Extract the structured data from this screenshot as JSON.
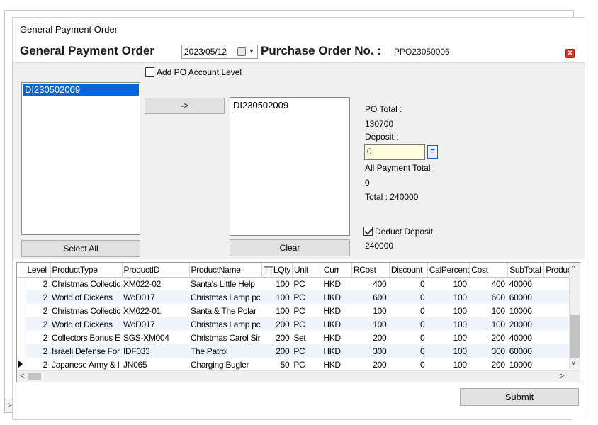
{
  "window": {
    "caption": "General Payment Order"
  },
  "header": {
    "title": "General Payment Order",
    "date": "2023/05/12",
    "po_label": "Purchase Order No. :",
    "po_number": "PPO23050006"
  },
  "left_panel": {
    "add_po_account_level": {
      "label": "Add PO Account Level",
      "checked": false
    },
    "items": [
      "DI230502009"
    ],
    "selected": "DI230502009",
    "select_all_label": "Select All"
  },
  "move_button_label": "->",
  "right_panel": {
    "items": [
      "DI230502009"
    ],
    "clear_label": "Clear"
  },
  "summary": {
    "po_total_label": "PO Total :",
    "po_total_value": "130700",
    "deposit_label": "Deposit :",
    "deposit_value": "0",
    "equals_label": "=",
    "all_payment_total_label": "All Payment Total :",
    "all_payment_total_value": "0",
    "total_text": "Total :  240000",
    "deduct_deposit": {
      "label": "Deduct Deposit",
      "checked": true
    },
    "deduct_value": "240000"
  },
  "grid": {
    "columns": [
      "Level",
      "ProductType",
      "ProductID",
      "ProductName",
      "TTLQty",
      "Unit",
      "Curr",
      "RCost",
      "Discount",
      "CalPercent",
      "Cost",
      "SubTotal",
      "ProductI"
    ],
    "rows": [
      [
        "2",
        "Christmas Collectic",
        "XM022-02",
        "Santa's Little Help",
        "100",
        "PC",
        "HKD",
        "400",
        "0",
        "100",
        "400",
        "40000",
        ""
      ],
      [
        "2",
        "World of Dickens",
        "WoD017",
        "Christmas Lamp pc",
        "100",
        "PC",
        "HKD",
        "600",
        "0",
        "100",
        "600",
        "60000",
        ""
      ],
      [
        "2",
        "Christmas Collectic",
        "XM022-01",
        "Santa & The Polar",
        "100",
        "PC",
        "HKD",
        "100",
        "0",
        "100",
        "100",
        "10000",
        ""
      ],
      [
        "2",
        "World of Dickens",
        "WoD017",
        "Christmas Lamp pc",
        "200",
        "PC",
        "HKD",
        "100",
        "0",
        "100",
        "100",
        "20000",
        ""
      ],
      [
        "2",
        "Collectors Bonus E",
        "SGS-XM004",
        "Christmas Carol Sir",
        "200",
        "Set",
        "HKD",
        "200",
        "0",
        "100",
        "200",
        "40000",
        ""
      ],
      [
        "2",
        "Israeli Defense For",
        "IDF033",
        "The Patrol",
        "200",
        "PC",
        "HKD",
        "300",
        "0",
        "100",
        "300",
        "60000",
        ""
      ],
      [
        "2",
        "Japanese Army & I",
        "JN065",
        "Charging Bugler",
        "50",
        "PC",
        "HKD",
        "200",
        "0",
        "100",
        "200",
        "10000",
        ""
      ]
    ],
    "current_row": 6
  },
  "submit_label": "Submit",
  "side_tab_label": ">"
}
